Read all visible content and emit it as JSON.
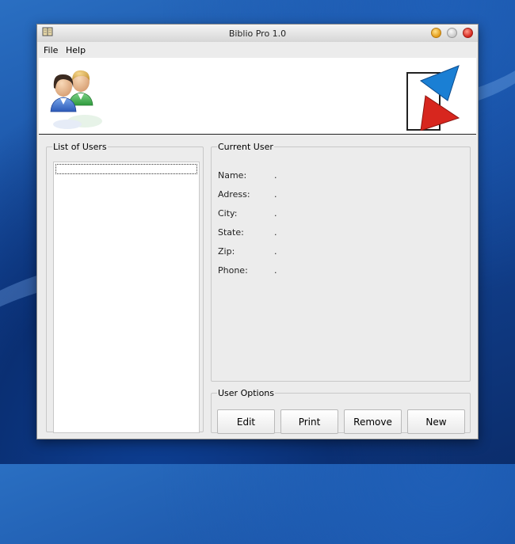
{
  "window": {
    "title": "Biblio Pro 1.0"
  },
  "menu": {
    "items": [
      "File",
      "Help"
    ]
  },
  "users_panel": {
    "legend": "List of Users"
  },
  "current_user": {
    "legend": "Current User",
    "fields": [
      {
        "label": "Name:",
        "value": "."
      },
      {
        "label": "Adress:",
        "value": "."
      },
      {
        "label": "City:",
        "value": "."
      },
      {
        "label": "State:",
        "value": "."
      },
      {
        "label": "Zip:",
        "value": "."
      },
      {
        "label": "Phone:",
        "value": "."
      }
    ]
  },
  "user_options": {
    "legend": "User Options",
    "buttons": [
      "Edit",
      "Print",
      "Remove",
      "New"
    ]
  },
  "colors": {
    "logo_blue": "#1a7fd4",
    "logo_red": "#d7261e",
    "window_bg": "#ececec"
  }
}
